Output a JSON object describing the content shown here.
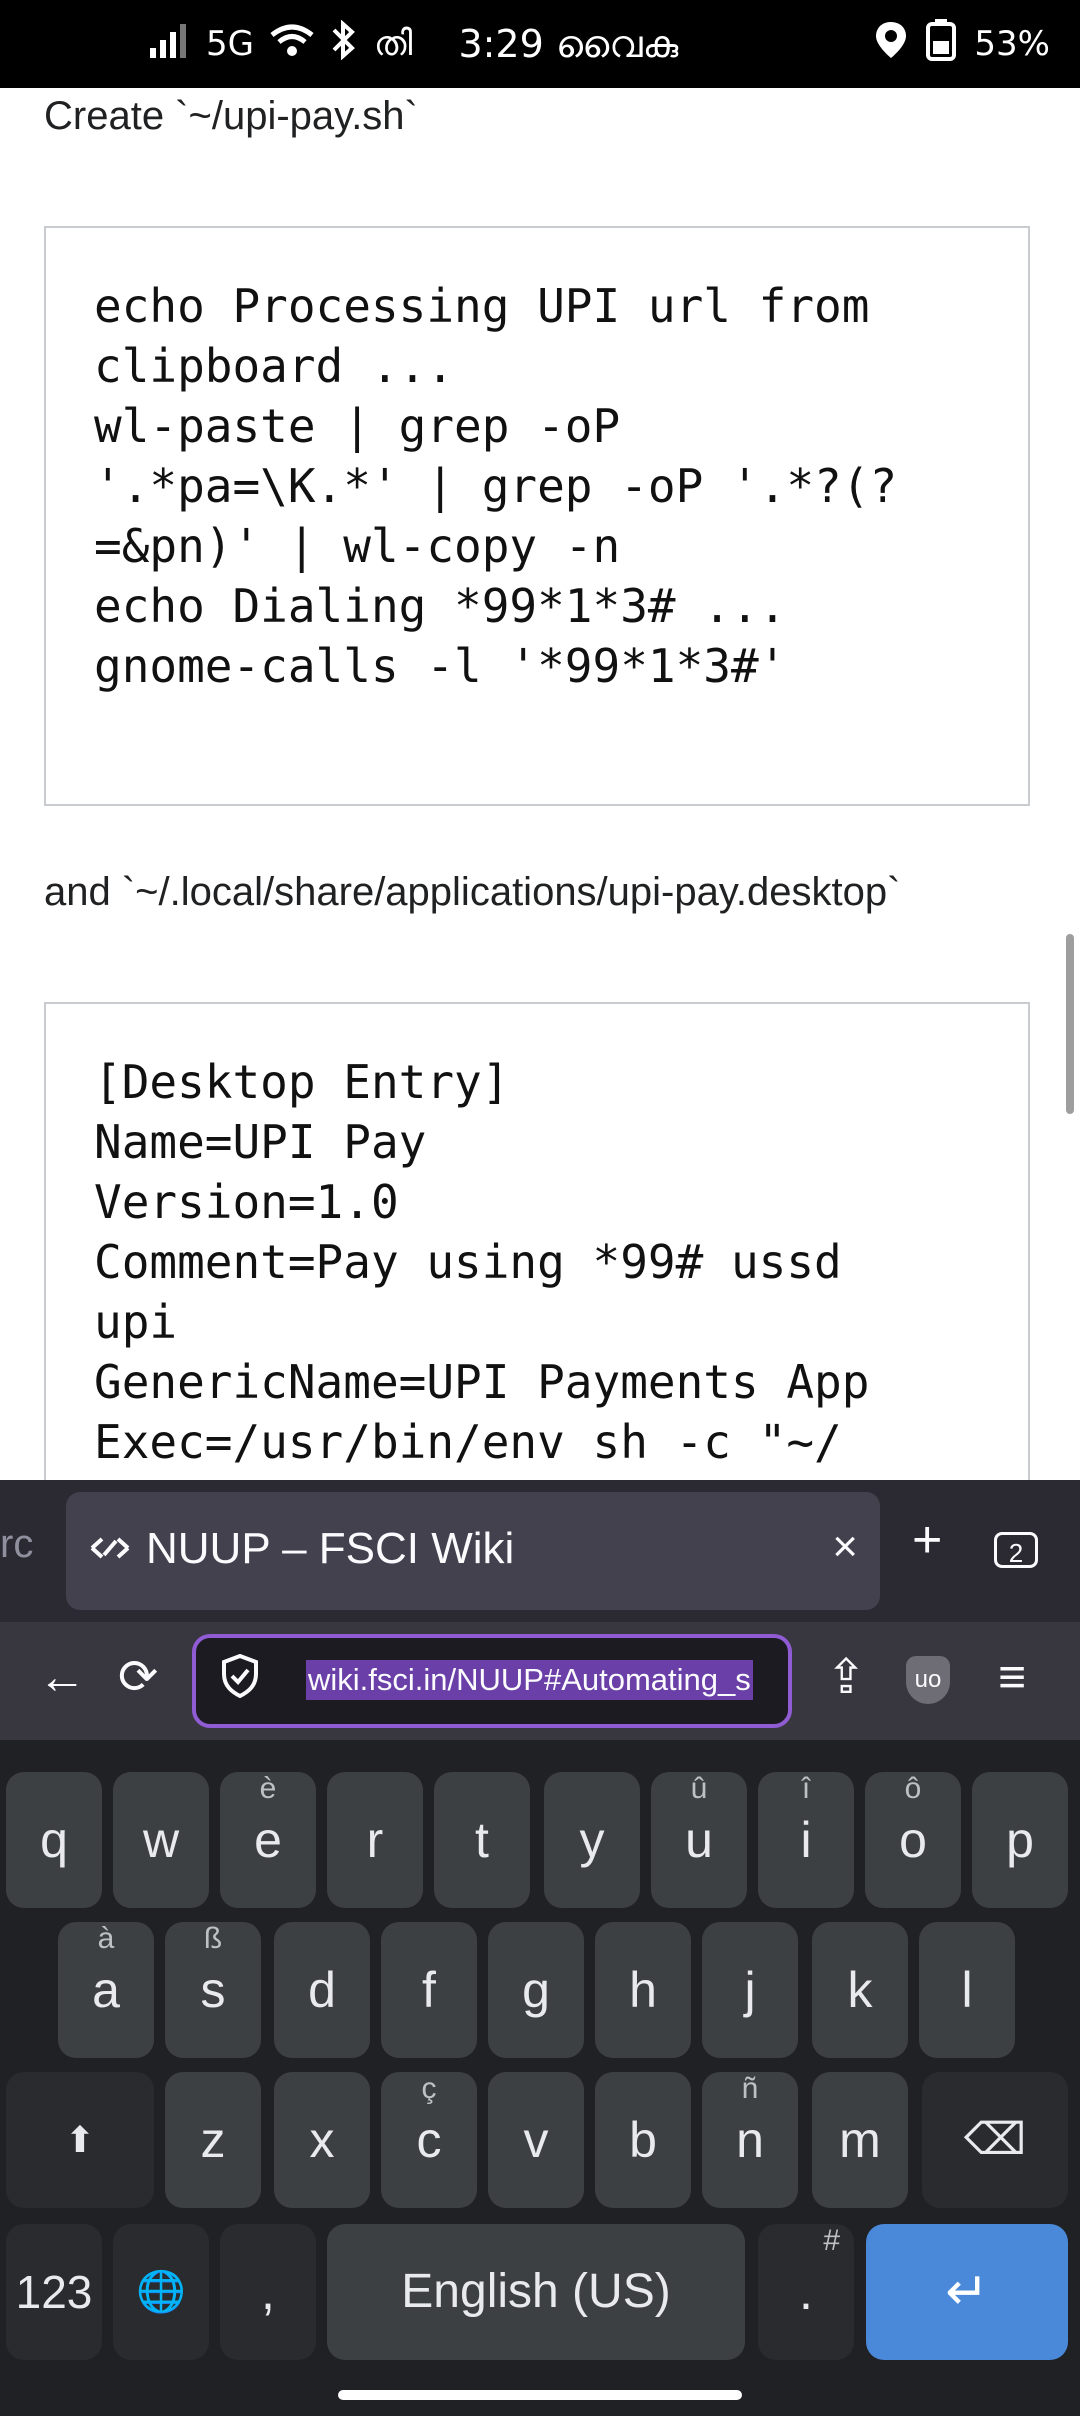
{
  "status_bar": {
    "network": "5G",
    "extra_icon": "തി",
    "time": "3:29 വൈകു",
    "battery": "53%",
    "icons": [
      "signal-icon",
      "wifi-icon",
      "bluetooth-icon",
      "location-icon",
      "battery-icon"
    ]
  },
  "article": {
    "para1": "Create `~/upi-pay.sh`",
    "code1": "echo Processing UPI url from\nclipboard ...\nwl-paste | grep -oP\n'.*pa=\\K.*' | grep -oP '.*?(?\n=&pn)' | wl-copy -n\necho Dialing *99*1*3# ...\ngnome-calls -l '*99*1*3#'",
    "para2": "and `~/.local/share/applications/upi-pay.desktop`",
    "code2": "[Desktop Entry]\nName=UPI Pay\nVersion=1.0\nComment=Pay using *99# ussd\nupi\nGenericName=UPI Payments App\nExec=/usr/bin/env sh -c \"~/"
  },
  "tabs": {
    "partial_prev": "rc",
    "active_title": "NUUP – FSCI Wiki",
    "close": "×",
    "new_tab": "+",
    "count": "2"
  },
  "toolbar": {
    "back": "←",
    "reload": "⟳",
    "url": "wiki.fsci.in/NUUP#Automating_s",
    "share": "⇪",
    "ublock": "uo",
    "menu": "≡"
  },
  "keyboard": {
    "row1": [
      {
        "k": "q",
        "h": ""
      },
      {
        "k": "w",
        "h": ""
      },
      {
        "k": "e",
        "h": "è"
      },
      {
        "k": "r",
        "h": ""
      },
      {
        "k": "t",
        "h": ""
      },
      {
        "k": "y",
        "h": ""
      },
      {
        "k": "u",
        "h": "û"
      },
      {
        "k": "i",
        "h": "î"
      },
      {
        "k": "o",
        "h": "ô"
      },
      {
        "k": "p",
        "h": ""
      }
    ],
    "row2": [
      {
        "k": "a",
        "h": "à"
      },
      {
        "k": "s",
        "h": "ß"
      },
      {
        "k": "d",
        "h": ""
      },
      {
        "k": "f",
        "h": ""
      },
      {
        "k": "g",
        "h": ""
      },
      {
        "k": "h",
        "h": ""
      },
      {
        "k": "j",
        "h": ""
      },
      {
        "k": "k",
        "h": ""
      },
      {
        "k": "l",
        "h": ""
      }
    ],
    "row3": [
      {
        "k": "z",
        "h": ""
      },
      {
        "k": "x",
        "h": ""
      },
      {
        "k": "c",
        "h": "ç"
      },
      {
        "k": "v",
        "h": ""
      },
      {
        "k": "b",
        "h": ""
      },
      {
        "k": "n",
        "h": "ñ"
      },
      {
        "k": "m",
        "h": ""
      }
    ],
    "shift": "⬆",
    "backspace": "⌫",
    "numbers": "123",
    "globe": "🌐",
    "comma": ",",
    "space": "English (US)",
    "period": ".",
    "period_hint": "#",
    "enter": "↵"
  }
}
